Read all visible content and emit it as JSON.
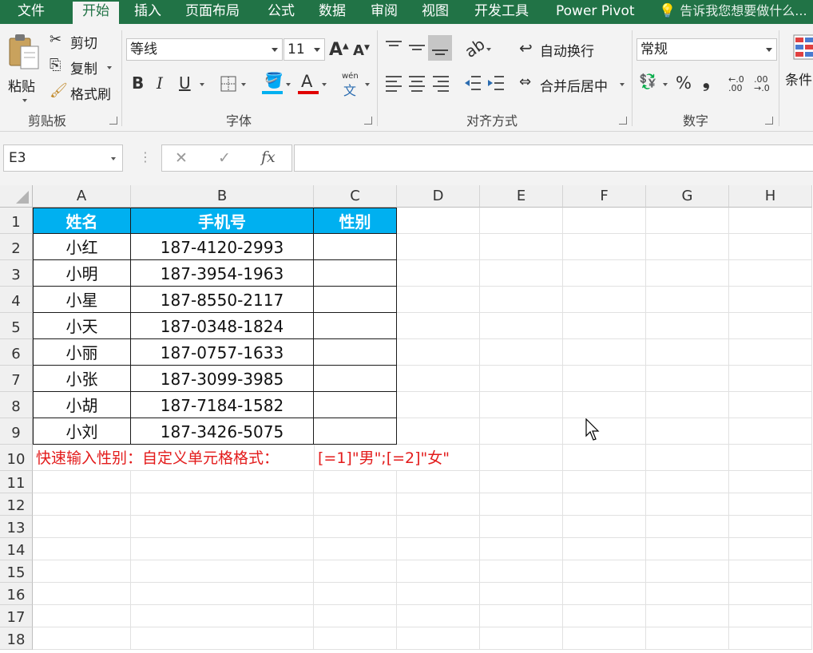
{
  "tabs": [
    "文件",
    "开始",
    "插入",
    "页面布局",
    "公式",
    "数据",
    "审阅",
    "视图",
    "开发工具",
    "Power Pivot"
  ],
  "active_tab": "开始",
  "tell_me": "告诉我您想要做什么...",
  "ribbon": {
    "clipboard": {
      "paste": "粘贴",
      "cut": "剪切",
      "copy": "复制",
      "format_painter": "格式刷",
      "label": "剪贴板"
    },
    "font": {
      "name": "等线",
      "size": "11",
      "bold": "B",
      "italic": "I",
      "underline": "U",
      "phonetic_top": "wén",
      "phonetic_bottom": "文",
      "label": "字体"
    },
    "alignment": {
      "wrap_text": "自动换行",
      "merge_center": "合并后居中",
      "label": "对齐方式"
    },
    "number": {
      "format": "常规",
      "percent": "%",
      "comma": "❟",
      "inc_decimal": "←.0 .00",
      "dec_decimal": ".00 →.0",
      "label": "数字"
    },
    "styles": {
      "conditional": "条件"
    }
  },
  "formula_bar": {
    "name_box": "E3",
    "cancel": "✕",
    "enter": "✓",
    "fx": "fx",
    "value": ""
  },
  "columns": [
    "A",
    "B",
    "C",
    "D",
    "E",
    "F",
    "G",
    "H"
  ],
  "rows": [
    "1",
    "2",
    "3",
    "4",
    "5",
    "6",
    "7",
    "8",
    "9",
    "10",
    "11",
    "12",
    "13",
    "14",
    "15",
    "16",
    "17",
    "18"
  ],
  "table": {
    "headers": [
      "姓名",
      "手机号",
      "性别"
    ],
    "data": [
      [
        "小红",
        "187-4120-2993",
        ""
      ],
      [
        "小明",
        "187-3954-1963",
        ""
      ],
      [
        "小星",
        "187-8550-2117",
        ""
      ],
      [
        "小天",
        "187-0348-1824",
        ""
      ],
      [
        "小丽",
        "187-0757-1633",
        ""
      ],
      [
        "小张",
        "187-3099-3985",
        ""
      ],
      [
        "小胡",
        "187-7184-1582",
        ""
      ],
      [
        "小刘",
        "187-3426-5075",
        ""
      ]
    ]
  },
  "note_label": "快速输入性别：自定义单元格格式：",
  "note_format": "[=1]\"男\";[=2]\"女\"",
  "colors": {
    "excel_green": "#217346",
    "header_fill": "#00b0f0",
    "note_red": "#e31b1b"
  }
}
